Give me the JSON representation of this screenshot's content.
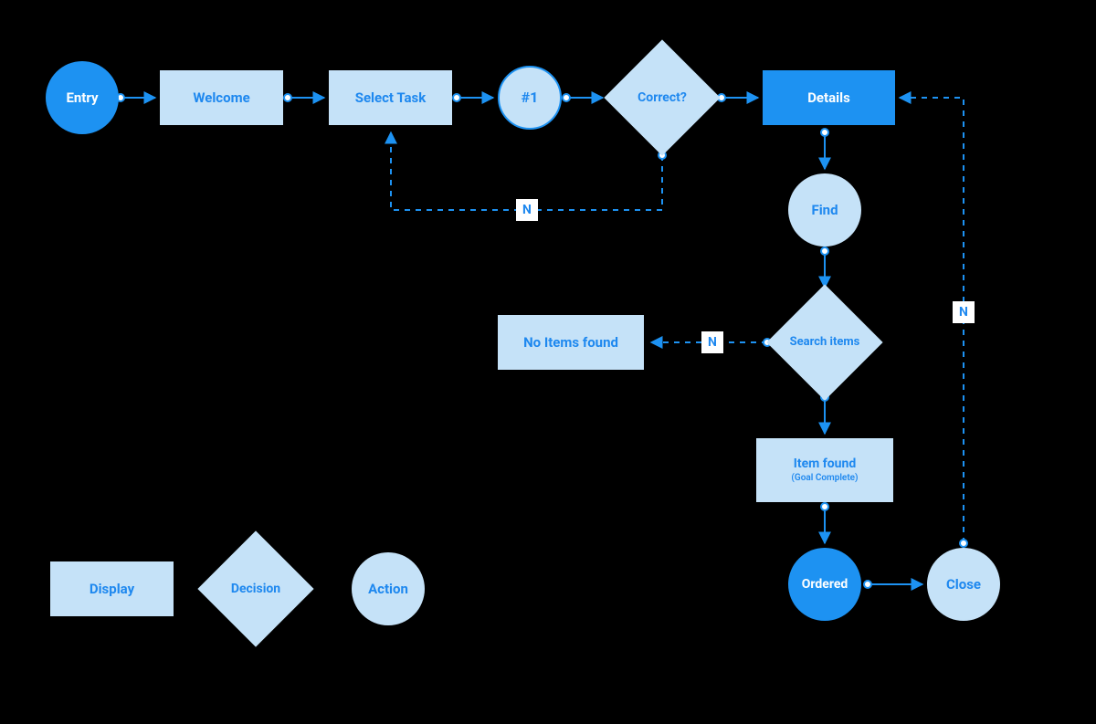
{
  "nodes": {
    "entry": "Entry",
    "welcome": "Welcome",
    "select_task": "Select Task",
    "num1": "#1",
    "correct": "Correct?",
    "details": "Details",
    "find": "Find",
    "search_items": "Search items",
    "no_items_found": "No Items found",
    "item_found": "Item found",
    "item_found_sub": "(Goal Complete)",
    "ordered": "Ordered",
    "close": "Close"
  },
  "labels": {
    "n1": "N",
    "n2": "N",
    "n3": "N"
  },
  "legend": {
    "display": "Display",
    "decision": "Decision",
    "action": "Action"
  },
  "chart_data": {
    "type": "flowchart",
    "nodes": [
      {
        "id": "entry",
        "label": "Entry",
        "shape": "circle",
        "style": "filled-blue"
      },
      {
        "id": "welcome",
        "label": "Welcome",
        "shape": "rect",
        "style": "light"
      },
      {
        "id": "select_task",
        "label": "Select Task",
        "shape": "rect",
        "style": "light"
      },
      {
        "id": "num1",
        "label": "#1",
        "shape": "circle",
        "style": "outlined"
      },
      {
        "id": "correct",
        "label": "Correct?",
        "shape": "diamond",
        "style": "light"
      },
      {
        "id": "details",
        "label": "Details",
        "shape": "rect",
        "style": "dark"
      },
      {
        "id": "find",
        "label": "Find",
        "shape": "circle",
        "style": "light"
      },
      {
        "id": "search_items",
        "label": "Search items",
        "shape": "diamond",
        "style": "light"
      },
      {
        "id": "no_items_found",
        "label": "No Items found",
        "shape": "rect",
        "style": "light"
      },
      {
        "id": "item_found",
        "label": "Item found (Goal Complete)",
        "shape": "rect",
        "style": "light"
      },
      {
        "id": "ordered",
        "label": "Ordered",
        "shape": "circle",
        "style": "filled-blue"
      },
      {
        "id": "close",
        "label": "Close",
        "shape": "circle",
        "style": "light"
      }
    ],
    "edges": [
      {
        "from": "entry",
        "to": "welcome",
        "style": "solid"
      },
      {
        "from": "welcome",
        "to": "select_task",
        "style": "solid"
      },
      {
        "from": "select_task",
        "to": "num1",
        "style": "solid"
      },
      {
        "from": "num1",
        "to": "correct",
        "style": "solid"
      },
      {
        "from": "correct",
        "to": "details",
        "style": "solid"
      },
      {
        "from": "correct",
        "to": "select_task",
        "style": "dashed",
        "label": "N"
      },
      {
        "from": "details",
        "to": "find",
        "style": "solid"
      },
      {
        "from": "find",
        "to": "search_items",
        "style": "solid"
      },
      {
        "from": "search_items",
        "to": "no_items_found",
        "style": "dashed",
        "label": "N"
      },
      {
        "from": "search_items",
        "to": "item_found",
        "style": "solid"
      },
      {
        "from": "item_found",
        "to": "ordered",
        "style": "solid"
      },
      {
        "from": "ordered",
        "to": "close",
        "style": "solid"
      },
      {
        "from": "close",
        "to": "details",
        "style": "dashed",
        "label": "N"
      }
    ],
    "legend": [
      {
        "shape": "rect",
        "label": "Display"
      },
      {
        "shape": "diamond",
        "label": "Decision"
      },
      {
        "shape": "circle",
        "label": "Action"
      }
    ]
  }
}
